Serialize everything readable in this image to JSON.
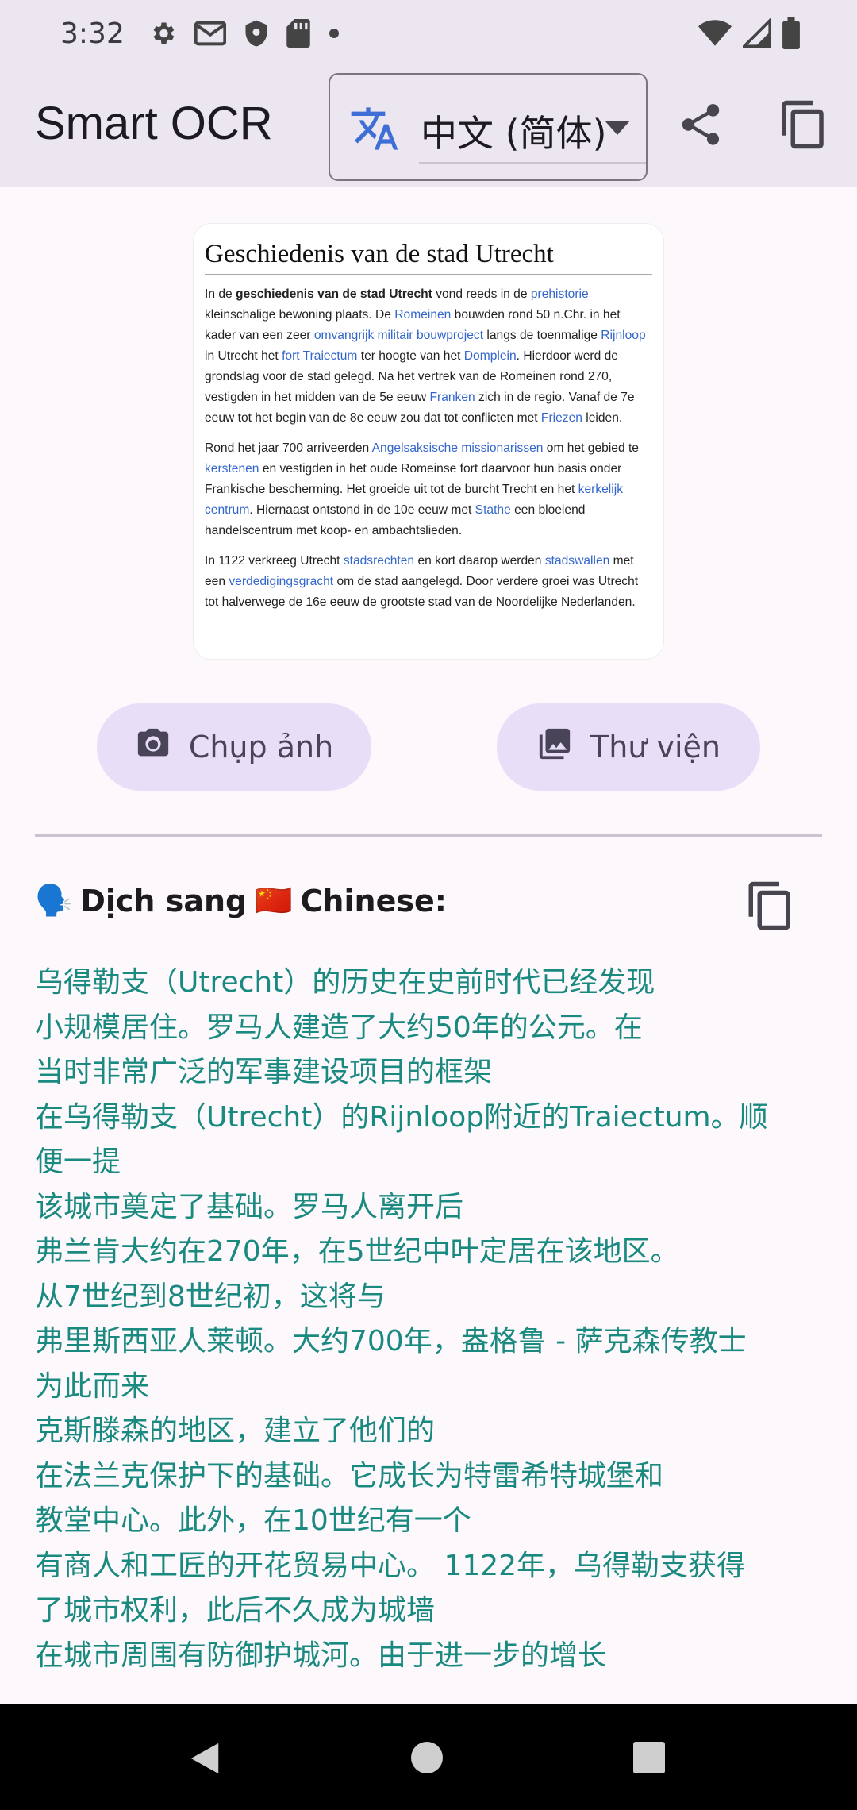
{
  "status_bar": {
    "time": "3:32",
    "icons": [
      "gear-icon",
      "gmail-icon",
      "shield-icon",
      "sd-card-icon",
      "dot-icon"
    ],
    "right_icons": [
      "wifi-icon",
      "signal-icon",
      "battery-icon"
    ]
  },
  "app_bar": {
    "title": "Smart OCR",
    "language_value": "中文 (简体)",
    "icons": [
      "translate-icon",
      "dropdown-caret-icon",
      "share-icon",
      "copy-icon"
    ]
  },
  "source_image": {
    "heading": "Geschiedenis van de stad Utrecht",
    "paragraphs": [
      [
        {
          "t": "In de ",
          "s": "text"
        },
        {
          "t": "geschiedenis van de stad Utrecht",
          "s": "bold"
        },
        {
          "t": " vond reeds in de ",
          "s": "text"
        },
        {
          "t": "prehistorie",
          "s": "link"
        },
        {
          "t": " kleinschalige bewoning plaats. De ",
          "s": "text"
        },
        {
          "t": "Romeinen",
          "s": "link"
        },
        {
          "t": " bouwden rond 50 n.Chr. in het kader van een zeer ",
          "s": "text"
        },
        {
          "t": "omvangrijk militair bouwproject",
          "s": "link"
        },
        {
          "t": " langs de toenmalige ",
          "s": "text"
        },
        {
          "t": "Rijnloop",
          "s": "link"
        },
        {
          "t": " in Utrecht het ",
          "s": "text"
        },
        {
          "t": "fort Traiectum",
          "s": "link"
        },
        {
          "t": " ter hoogte van het ",
          "s": "text"
        },
        {
          "t": "Domplein",
          "s": "link"
        },
        {
          "t": ". Hierdoor werd de grondslag voor de stad gelegd. Na het vertrek van de Romeinen rond 270, vestigden in het midden van de 5e eeuw ",
          "s": "text"
        },
        {
          "t": "Franken",
          "s": "link"
        },
        {
          "t": " zich in de regio. Vanaf de 7e eeuw tot het begin van de 8e eeuw zou dat tot conflicten met ",
          "s": "text"
        },
        {
          "t": "Friezen",
          "s": "link"
        },
        {
          "t": " leiden.",
          "s": "text"
        }
      ],
      [
        {
          "t": "Rond het jaar 700 arriveerden ",
          "s": "text"
        },
        {
          "t": "Angelsaksische missionarissen",
          "s": "link"
        },
        {
          "t": " om het gebied te ",
          "s": "text"
        },
        {
          "t": "kerstenen",
          "s": "link"
        },
        {
          "t": " en vestigden in het oude Romeinse fort daarvoor hun basis onder Frankische bescherming. Het groeide uit tot de burcht Trecht en het ",
          "s": "text"
        },
        {
          "t": "kerkelijk centrum",
          "s": "link"
        },
        {
          "t": ". Hiernaast ontstond in de 10e eeuw met ",
          "s": "text"
        },
        {
          "t": "Stathe",
          "s": "link"
        },
        {
          "t": " een bloeiend handelscentrum met koop- en ambachtslieden.",
          "s": "text"
        }
      ],
      [
        {
          "t": "In 1122 verkreeg Utrecht ",
          "s": "text"
        },
        {
          "t": "stadsrechten",
          "s": "link"
        },
        {
          "t": " en kort daarop werden ",
          "s": "text"
        },
        {
          "t": "stadswallen",
          "s": "link"
        },
        {
          "t": " met een ",
          "s": "text"
        },
        {
          "t": "verdedigingsgracht",
          "s": "link"
        },
        {
          "t": " om de stad aangelegd. Door verdere groei was Utrecht tot halverwege de 16e eeuw de grootste stad van de Noordelijke Nederlanden.",
          "s": "text"
        }
      ]
    ]
  },
  "buttons": {
    "camera_label": "Chụp ảnh",
    "gallery_label": "Thư viện"
  },
  "result": {
    "header_emoji": "🗣️",
    "header_prefix": "Dịch sang",
    "header_flag": "🇨🇳",
    "header_lang": "Chinese:",
    "lines": [
      "乌得勒支（Utrecht）的历史在史前时代已经发现",
      "小规模居住。罗马人建造了大约50年的公元。在",
      "当时非常广泛的军事建设项目的框架",
      "在乌得勒支（Utrecht）的Rijnloop附近的Traiectum。顺",
      "便一提",
      "该城市奠定了基础。罗马人离开后",
      "弗兰肯大约在270年，在5世纪中叶定居在该地区。",
      "从7世纪到8世纪初，这将与",
      "弗里斯西亚人莱顿。大约700年，盎格鲁 - 萨克森传教士",
      "为此而来",
      "克斯滕森的地区，建立了他们的",
      "在法兰克保护下的基础。它成长为特雷希特城堡和",
      "教堂中心。此外，在10世纪有一个",
      "有商人和工匠的开花贸易中心。 1122年，乌得勒支获得",
      "了城市权利，此后不久成为城墙",
      "在城市周围有防御护城河。由于进一步的增长"
    ]
  },
  "colors": {
    "app_bar_bg": "#ece6f0",
    "translate_icon": "#3f6fd6",
    "tonal_button_bg": "#e8def8",
    "result_text": "#1a8a80",
    "nav_bar": "#000000"
  }
}
